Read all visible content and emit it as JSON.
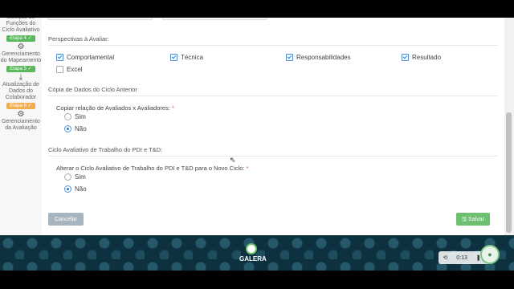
{
  "sidebar": {
    "items": [
      {
        "label": "Seleção de Funções do Ciclo Avaliativo"
      },
      {
        "badge": "Etapa 4",
        "label": "Gerenciamento do Mapeamento",
        "icon": "gears-icon"
      },
      {
        "badge": "Etapa 5",
        "label": "Atualização de Dados do Colaborador",
        "icon": "download-icon"
      },
      {
        "badge": "Etapa 6",
        "label": "Gerenciamento da Avaliação",
        "icon": "gears-icon"
      }
    ]
  },
  "perspectives": {
    "title": "Perspectivas à Avaliar:",
    "options": [
      {
        "label": "Comportamental",
        "checked": true
      },
      {
        "label": "Técnica",
        "checked": true
      },
      {
        "label": "Responsabilidades",
        "checked": true
      },
      {
        "label": "Resultado",
        "checked": true
      },
      {
        "label": "Excel",
        "checked": false
      }
    ]
  },
  "copy_section": {
    "title": "Cópia de Dados do Ciclo Anterior",
    "question": "Copiar relação de Avaliados x Avaliadores:",
    "required": "*",
    "yes": "Sim",
    "no": "Não",
    "selected": "Não"
  },
  "pdi_section": {
    "title": "Ciclo Avaliativo de Trabalho do PDI e T&D:",
    "question": "Alterar o Ciclo Avaliativo de Trabalho do PDI e T&D para o Novo Ciclo:",
    "required": "*",
    "yes": "Sim",
    "no": "Não",
    "selected": "Não"
  },
  "actions": {
    "cancel": "Cancelar",
    "save": "Salvar"
  },
  "footer": {
    "brand": "GALERA",
    "player_time": "0:13"
  },
  "colors": {
    "badge": "#5cb85c",
    "save": "#6cc070",
    "cancel": "#a7b5c0",
    "footer": "#0e3140"
  }
}
